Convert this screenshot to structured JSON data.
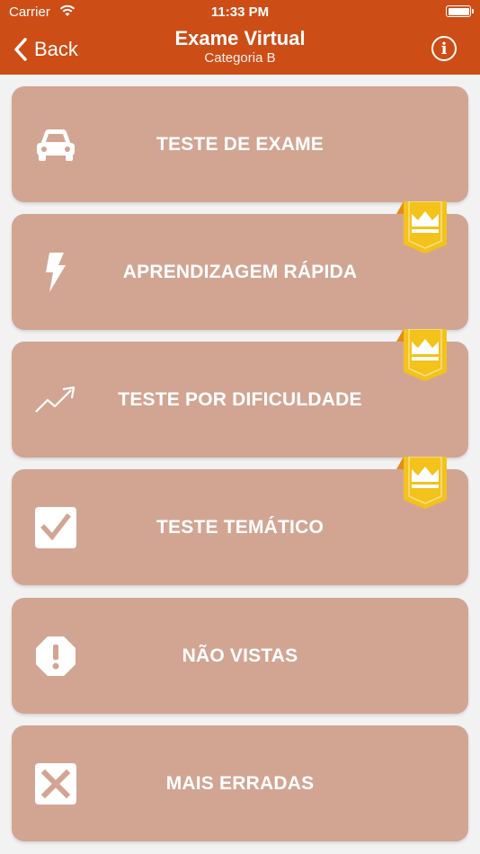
{
  "status_bar": {
    "carrier": "Carrier",
    "time": "11:33 PM"
  },
  "nav": {
    "back_label": "Back",
    "title": "Exame Virtual",
    "subtitle": "Categoria B",
    "info_glyph": "i"
  },
  "colors": {
    "header": "#cd4d17",
    "card": "#d2a593",
    "ribbon": "#f3c21b",
    "ribbon_fold": "#e88a1a"
  },
  "menu": [
    {
      "label": "TESTE DE EXAME",
      "icon": "car-icon",
      "premium": false
    },
    {
      "label": "APRENDIZAGEM RÁPIDA",
      "icon": "lightning-icon",
      "premium": true
    },
    {
      "label": "TESTE POR DIFICULDADE",
      "icon": "trend-up-icon",
      "premium": true
    },
    {
      "label": "TESTE TEMÁTICO",
      "icon": "checkbox-icon",
      "premium": true
    },
    {
      "label": "NÃO VISTAS",
      "icon": "exclamation-octagon-icon",
      "premium": false
    },
    {
      "label": "MAIS ERRADAS",
      "icon": "x-box-icon",
      "premium": false
    }
  ]
}
